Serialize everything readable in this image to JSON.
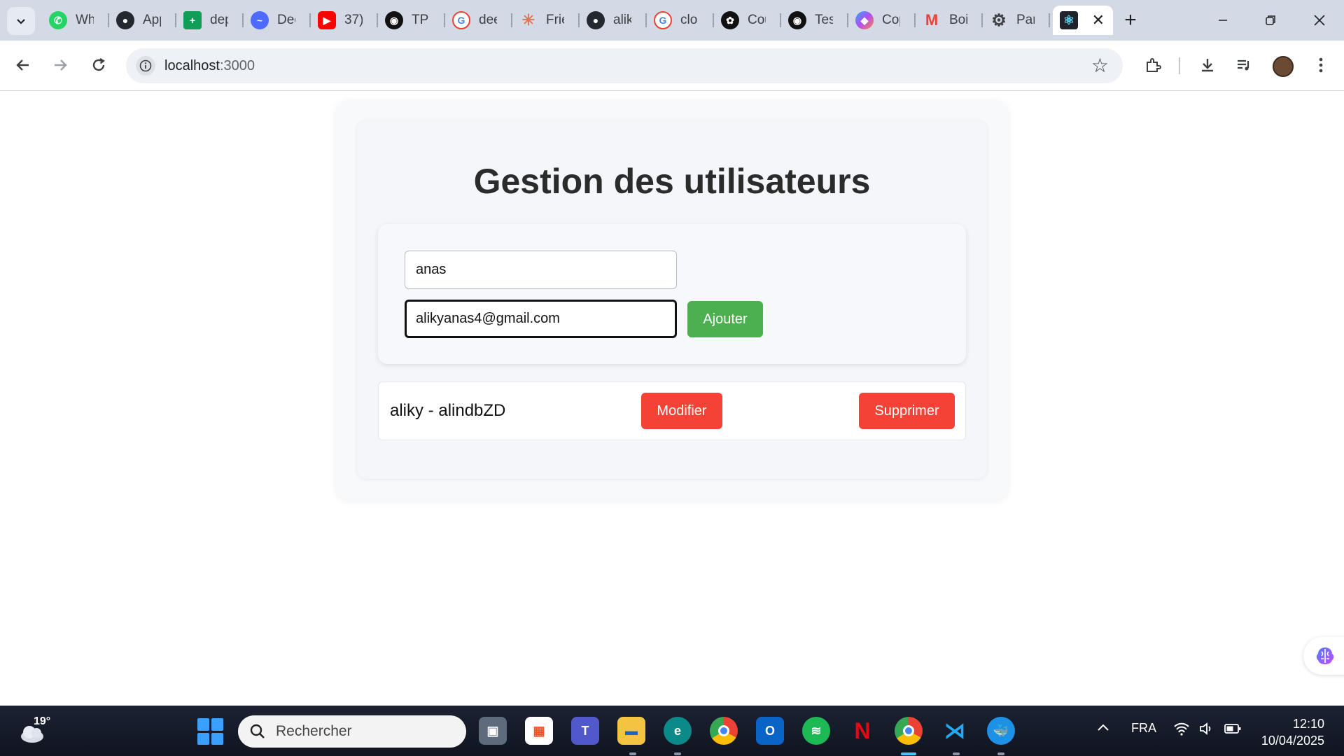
{
  "browser": {
    "tabs": [
      {
        "label": "WhatsApp",
        "icon": "whatsapp-icon",
        "color": "#25d366"
      },
      {
        "label": "App",
        "icon": "github-icon",
        "color": "#24292f"
      },
      {
        "label": "dep",
        "icon": "sheets-icon",
        "color": "#0f9d58"
      },
      {
        "label": "Dec",
        "icon": "deepseek-icon",
        "color": "#4d6bfe"
      },
      {
        "label": "37)",
        "icon": "youtube-icon",
        "color": "#ff0000"
      },
      {
        "label": "TP",
        "icon": "bot-icon",
        "color": "#111111"
      },
      {
        "label": "dee",
        "icon": "google-icon",
        "color": "#4285f4"
      },
      {
        "label": "Frie",
        "icon": "claude-icon",
        "color": "#d97757"
      },
      {
        "label": "alik",
        "icon": "github-icon",
        "color": "#24292f"
      },
      {
        "label": "clo",
        "icon": "google-icon",
        "color": "#4285f4"
      },
      {
        "label": "Cou",
        "icon": "openai-icon",
        "color": "#111111"
      },
      {
        "label": "Tes",
        "icon": "bot-icon",
        "color": "#111111"
      },
      {
        "label": "Cop",
        "icon": "copilot-icon",
        "color": "#8a5cf6"
      },
      {
        "label": "Boi",
        "icon": "gmail-icon",
        "color": "#ea4335"
      },
      {
        "label": "Par",
        "icon": "gear-icon",
        "color": "#3c4043"
      }
    ],
    "active_tab_icon": "react-icon",
    "url_host": "localhost",
    "url_port": ":3000"
  },
  "page": {
    "title": "Gestion des utilisateurs",
    "form": {
      "name_value": "anas",
      "email_value": "alikyanas4@gmail.com",
      "add_label": "Ajouter"
    },
    "users": [
      {
        "text": "aliky - alindbZD",
        "edit_label": "Modifier",
        "delete_label": "Supprimer"
      }
    ],
    "colors": {
      "add": "#4caf50",
      "danger": "#f44336"
    }
  },
  "taskbar": {
    "temperature": "19°",
    "search_placeholder": "Rechercher",
    "language": "FRA",
    "time": "12:10",
    "date": "10/04/2025",
    "apps": [
      "task-view-icon",
      "store-icon",
      "teams-icon",
      "file-explorer-icon",
      "edge-icon",
      "chrome-icon",
      "outlook-icon",
      "spotify-icon",
      "netflix-icon",
      "chrome-profile-icon",
      "vscode-icon",
      "docker-icon"
    ]
  }
}
